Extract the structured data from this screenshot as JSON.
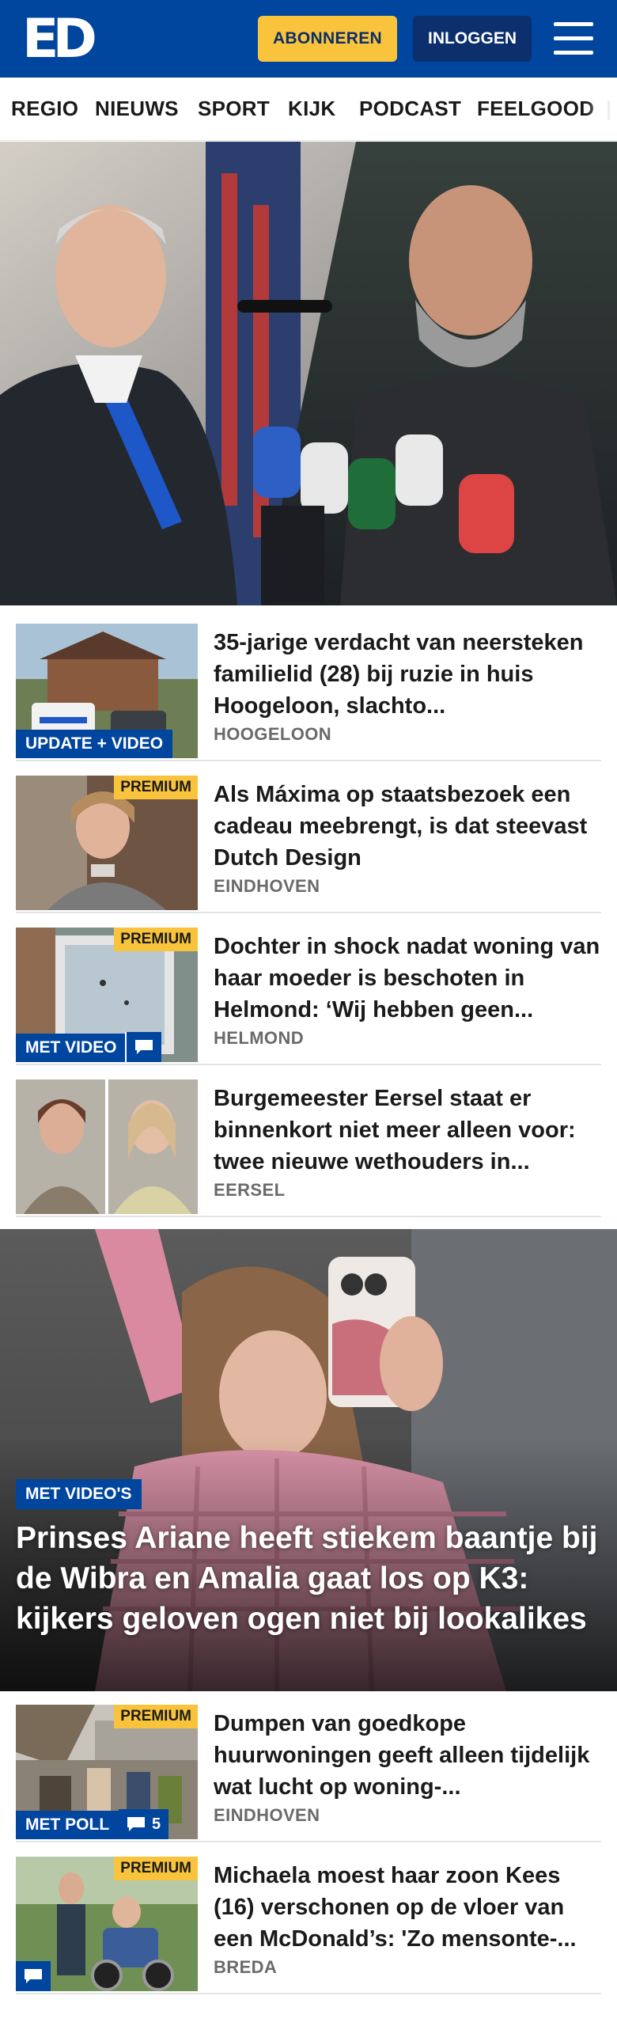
{
  "header": {
    "logo_text": "ED",
    "subscribe_label": "ABONNEREN",
    "login_label": "INLOGGEN",
    "menu_icon": "hamburger-menu-icon",
    "background_color": "#00459e",
    "accent_color": "#f9c43b"
  },
  "nav": {
    "items": [
      "REGIO",
      "NIEUWS",
      "SPORT",
      "KIJK",
      "PODCAST",
      "FEELGOOD"
    ]
  },
  "hero": {
    "image": "hero-photo"
  },
  "articles": [
    {
      "title": "35-jarige verdacht van neersteken familielid (28) bij ruzie in huis Hoogeloon, slachto...",
      "location": "HOOGELOON",
      "badge": "UPDATE + VIDEO"
    },
    {
      "title": "Als Máxima op staatsbezoek een cadeau meebrengt, is dat steevast Dutch Design",
      "location": "EINDHOVEN",
      "premium": "PREMIUM"
    },
    {
      "title": "Dochter in shock nadat woning van haar moeder is beschoten in Helmond: ‘Wij hebben geen...",
      "location": "HELMOND",
      "premium": "PREMIUM",
      "badge": "MET VIDEO"
    },
    {
      "title": "Burgemeester Eersel staat er binnenkort niet meer alleen voor: twee nieuwe wethouders in...",
      "location": "EERSEL"
    }
  ],
  "feature": {
    "badge": "MET VIDEO'S",
    "title": "Prinses Ariane heeft stiekem baantje bij de Wibra en Amalia gaat los op K3: kijkers geloven ogen niet bij lookalikes"
  },
  "articles2": [
    {
      "title": "Dumpen van goedkope huurwoningen geeft alleen tijdelijk wat lucht op woning-...",
      "location": "EINDHOVEN",
      "premium": "PREMIUM",
      "badge": "MET POLL",
      "comments": "5"
    },
    {
      "title": "Michaela moest haar zoon Kees (16) verschonen op de vloer van een McDonald’s: 'Zo mensonte-...",
      "location": "BREDA",
      "premium": "PREMIUM"
    }
  ]
}
